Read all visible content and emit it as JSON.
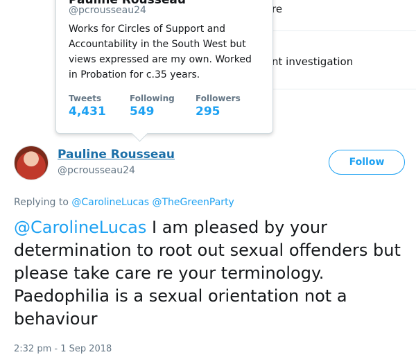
{
  "background": {
    "frag_top": "re",
    "frag_mid": "nt investigation"
  },
  "hovercard": {
    "name": "Pauline Rousseau",
    "handle": "@pcrousseau24",
    "bio": "Works for Circles of Support and Accountability in the South West but views expressed are my own. Worked in Probation for c.35 years.",
    "stats": [
      {
        "label": "Tweets",
        "value": "4,431"
      },
      {
        "label": "Following",
        "value": "549"
      },
      {
        "label": "Followers",
        "value": "295"
      }
    ]
  },
  "tweet": {
    "author_name": "Pauline Rousseau",
    "author_handle": "@pcrousseau24",
    "follow_label": "Follow",
    "replying_prefix": "Replying to",
    "replying_mentions": [
      "@CarolineLucas",
      "@TheGreenParty"
    ],
    "text_mention": "@CarolineLucas",
    "text_body": " I am pleased by your determination to root out sexual offenders but please take care re your terminology. Paedophilia is a sexual orientation not a behaviour",
    "timestamp": "2:32 pm - 1 Sep 2018"
  },
  "colors": {
    "link": "#1da1f2",
    "text": "#14171a",
    "muted": "#657786"
  }
}
